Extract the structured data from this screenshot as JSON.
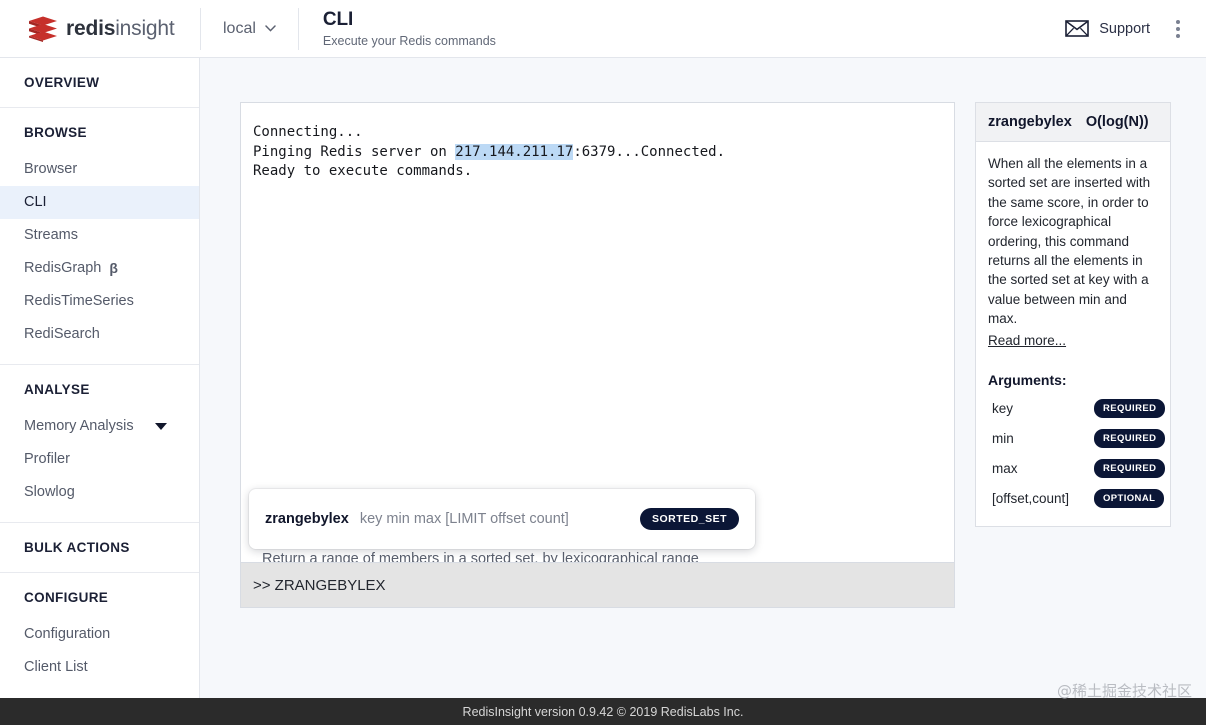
{
  "brand": {
    "bold": "redis",
    "light": "insight"
  },
  "header": {
    "connection": "local",
    "title": "CLI",
    "subtitle": "Execute your Redis commands",
    "support_label": "Support"
  },
  "sidebar": {
    "groups": [
      {
        "title": "OVERVIEW",
        "items": []
      },
      {
        "title": "BROWSE",
        "items": [
          {
            "label": "Browser",
            "active": false
          },
          {
            "label": "CLI",
            "active": true
          },
          {
            "label": "Streams",
            "active": false
          },
          {
            "label": "RedisGraph",
            "badge": "β",
            "active": false
          },
          {
            "label": "RedisTimeSeries",
            "active": false
          },
          {
            "label": "RediSearch",
            "active": false
          }
        ]
      },
      {
        "title": "ANALYSE",
        "items": [
          {
            "label": "Memory Analysis",
            "caret": true,
            "active": false
          },
          {
            "label": "Profiler",
            "active": false
          },
          {
            "label": "Slowlog",
            "active": false
          }
        ]
      },
      {
        "title": "BULK ACTIONS",
        "items": []
      },
      {
        "title": "CONFIGURE",
        "items": [
          {
            "label": "Configuration",
            "active": false
          },
          {
            "label": "Client List",
            "active": false
          }
        ]
      }
    ]
  },
  "console": {
    "line1": "Connecting...",
    "line2_pre": "Pinging Redis server on ",
    "line2_ip": "217.144.211.17",
    "line2_post": ":6379...Connected.",
    "line3": "Ready to execute commands."
  },
  "command_input": {
    "value": ">> ZRANGEBYLEX"
  },
  "autocomplete": {
    "command": "zrangebylex",
    "arguments": "key min max [LIMIT offset count]",
    "group_tag": "SORTED_SET",
    "description": "Return a range of members in a sorted set, by lexicographical range"
  },
  "help_panel": {
    "command": "zrangebylex",
    "complexity": "O(log(N))",
    "description": "When all the elements in a sorted set are inserted with the same score, in order to force lexicographical ordering, this command returns all the elements in the sorted set at key with a value between min and max.",
    "read_more": "Read more...",
    "arguments_title": "Arguments:",
    "arguments": [
      {
        "name": "key",
        "requirement": "REQUIRED"
      },
      {
        "name": "min",
        "requirement": "REQUIRED"
      },
      {
        "name": "max",
        "requirement": "REQUIRED"
      },
      {
        "name": "[offset,count]",
        "requirement": "OPTIONAL"
      }
    ]
  },
  "footer": {
    "text": "RedisInsight version 0.9.42 © 2019 RedisLabs Inc."
  },
  "watermark": {
    "text": "@稀土掘金技术社区"
  },
  "colors": {
    "brand_red": "#c6302b",
    "active_nav": "#eaf1fb",
    "badge_navy": "#0b1636",
    "selection_blue": "#bcd9f5",
    "page_bg": "#f6f8fb",
    "footer_bg": "#2b2b2b"
  }
}
